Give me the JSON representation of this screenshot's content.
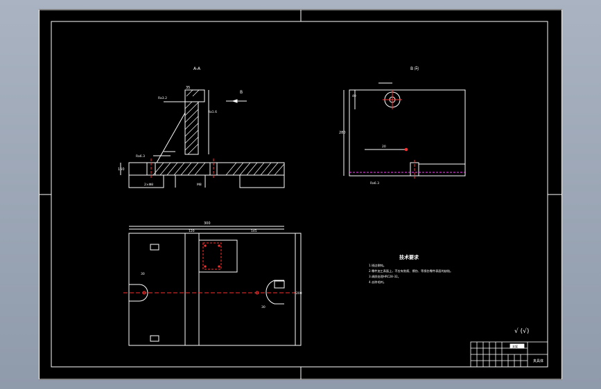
{
  "sheet": {
    "view_labels": {
      "section": "A-A",
      "side_view": "B 向"
    },
    "direction_mark": "B",
    "tech_requirements": {
      "title": "技术要求",
      "items": [
        "1.锐边倒钝。",
        "2.零件加工表面上，不应有划痕、擦伤、等损伤零件表面的缺陷。",
        "3.调质处理HRC28-32。",
        "4.去除毛刺。"
      ]
    },
    "roughness_note": "√ (√)",
    "title_block": {
      "part_name": "支架",
      "drawing_title": "夹具体"
    },
    "dims": {
      "section_height": "150",
      "top_width": "35",
      "side_width": "280",
      "side_hole_height": "40",
      "plan_width": "300",
      "plan_inner": "120",
      "plan_offset": "145",
      "plan_depth": "200",
      "slot_width": "30",
      "gap": "20",
      "hole_dia": "2×Φ8",
      "bolt": "M8"
    },
    "roughness": {
      "ra_a": "Ra3.2",
      "ra_b": "Ra1.6",
      "ra_c": "Ra6.3"
    },
    "colors": {
      "background": "#000000",
      "line": "#ffffff",
      "center_line": "#ff3030",
      "hidden_line": "#ff40ff"
    }
  }
}
